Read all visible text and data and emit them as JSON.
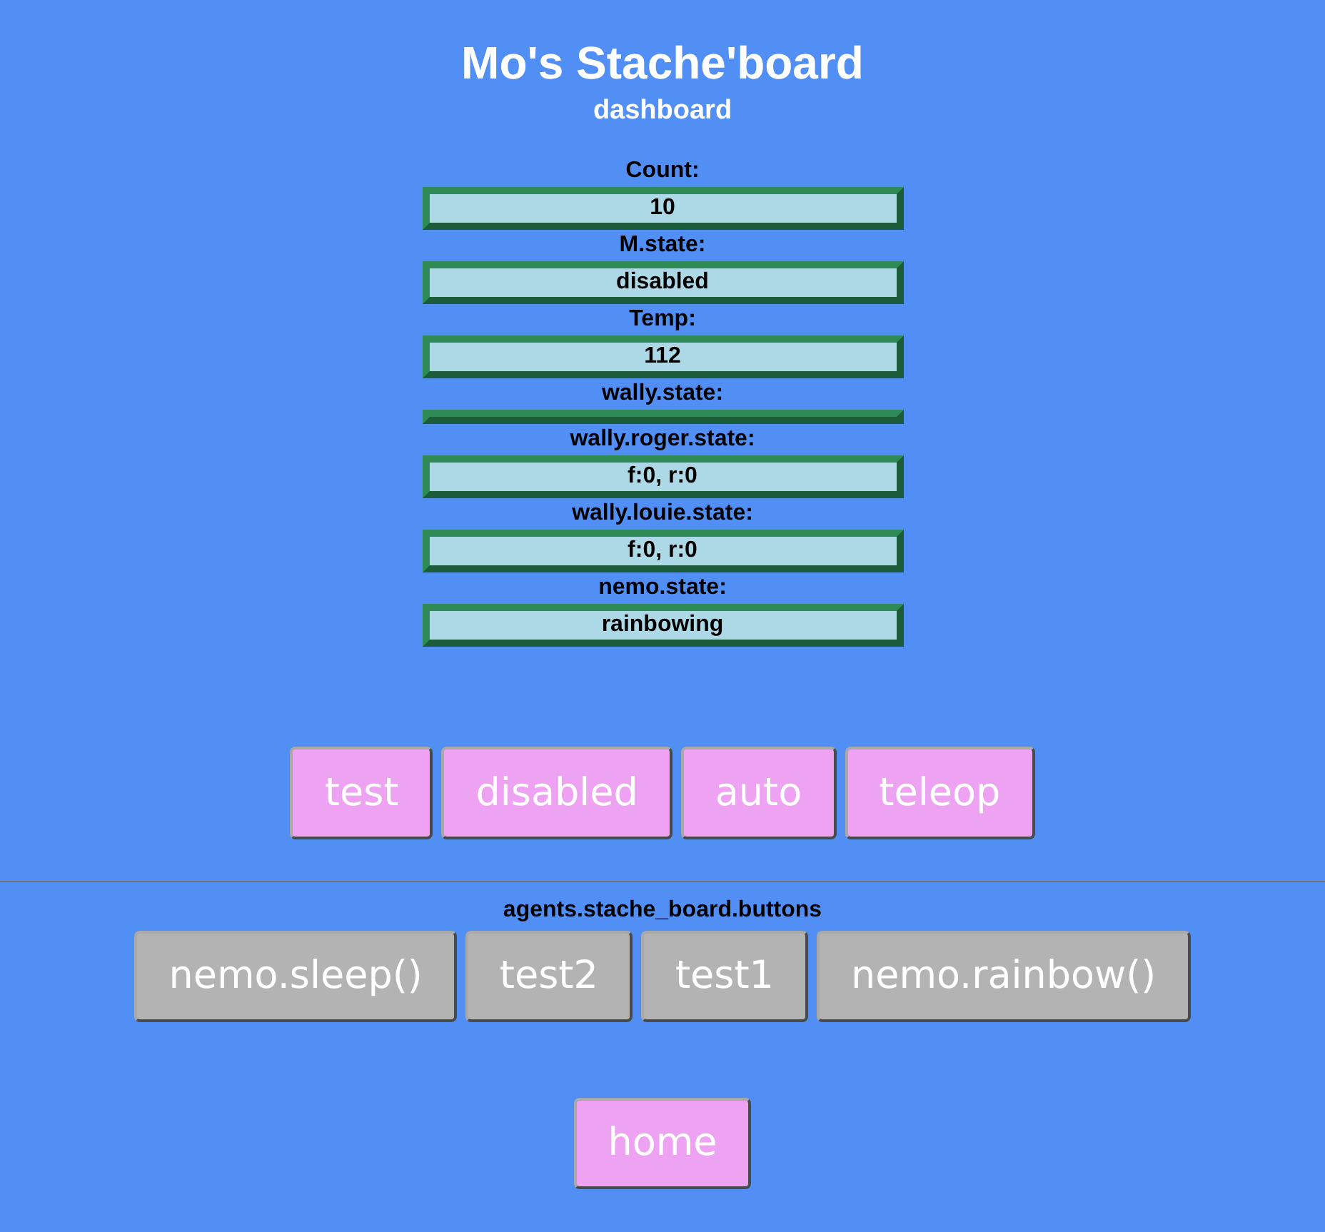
{
  "header": {
    "title": "Mo's Stache'board",
    "subtitle": "dashboard"
  },
  "fields": [
    {
      "label": "Count:",
      "value": "10"
    },
    {
      "label": "M.state:",
      "value": "disabled"
    },
    {
      "label": "Temp:",
      "value": "112"
    },
    {
      "label": "wally.state:"
    },
    {
      "label": "wally.roger.state:",
      "value": "f:0, r:0"
    },
    {
      "label": "wally.louie.state:",
      "value": "f:0, r:0"
    },
    {
      "label": "nemo.state:",
      "value": "rainbowing"
    }
  ],
  "mode_buttons": [
    "test",
    "disabled",
    "auto",
    "teleop"
  ],
  "agent_section": {
    "title": "agents.stache_board.buttons",
    "buttons": [
      "nemo.sleep()",
      "test2",
      "test1",
      "nemo.rainbow()"
    ]
  },
  "nav_buttons": [
    "home"
  ]
}
